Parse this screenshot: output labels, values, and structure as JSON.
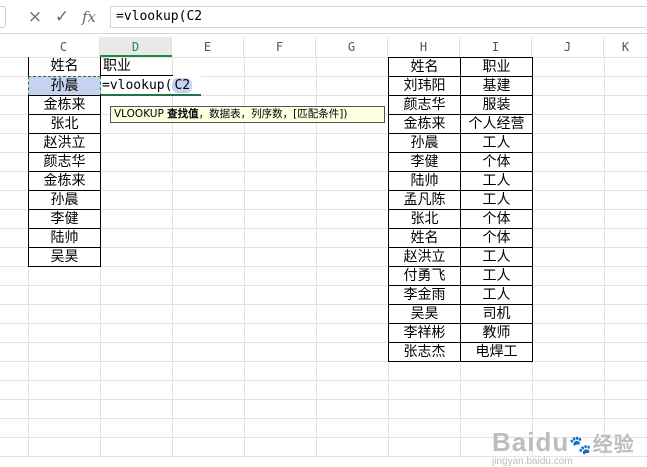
{
  "formula_bar": {
    "cancel_icon": "×",
    "confirm_icon": "✓",
    "fx_label": "fx",
    "formula": "=vlookup(C2"
  },
  "columns": [
    "C",
    "D",
    "E",
    "F",
    "G",
    "H",
    "I",
    "J",
    "K"
  ],
  "left_table": {
    "header": "姓名",
    "names": [
      "孙晨",
      "金栋来",
      "张北",
      "赵洪立",
      "颜志华",
      "金栋来",
      "孙晨",
      "李健",
      "陆帅",
      "吴昊"
    ]
  },
  "d_column": {
    "header": "职业",
    "editing_prefix": "=vlookup(",
    "editing_ref": "C2"
  },
  "tooltip": {
    "fn": "VLOOKUP",
    "arg_bold": "查找值",
    "rest": "，数据表，列序数，[匹配条件])"
  },
  "right_table": {
    "headers": [
      "姓名",
      "职业"
    ],
    "rows": [
      [
        "刘玮阳",
        "基建"
      ],
      [
        "颜志华",
        "服装"
      ],
      [
        "金栋来",
        "个人经营"
      ],
      [
        "孙晨",
        "工人"
      ],
      [
        "李健",
        "个体"
      ],
      [
        "陆帅",
        "工人"
      ],
      [
        "孟凡陈",
        "工人"
      ],
      [
        "张北",
        "个体"
      ],
      [
        "姓名",
        "个体"
      ],
      [
        "赵洪立",
        "工人"
      ],
      [
        "付勇飞",
        "工人"
      ],
      [
        "李金雨",
        "工人"
      ],
      [
        "吴昊",
        "司机"
      ],
      [
        "李祥彬",
        "教师"
      ],
      [
        "张志杰",
        "电焊工"
      ]
    ]
  },
  "watermark": {
    "brand": "Baidu",
    "brand_cn": "经验",
    "url": "jingyan.baidu.com"
  },
  "colors": {
    "selection_fill": "#c6d3f0",
    "selection_border": "#217346",
    "header_selected": "#1e8a4a",
    "tooltip_bg": "#ffffe1"
  }
}
